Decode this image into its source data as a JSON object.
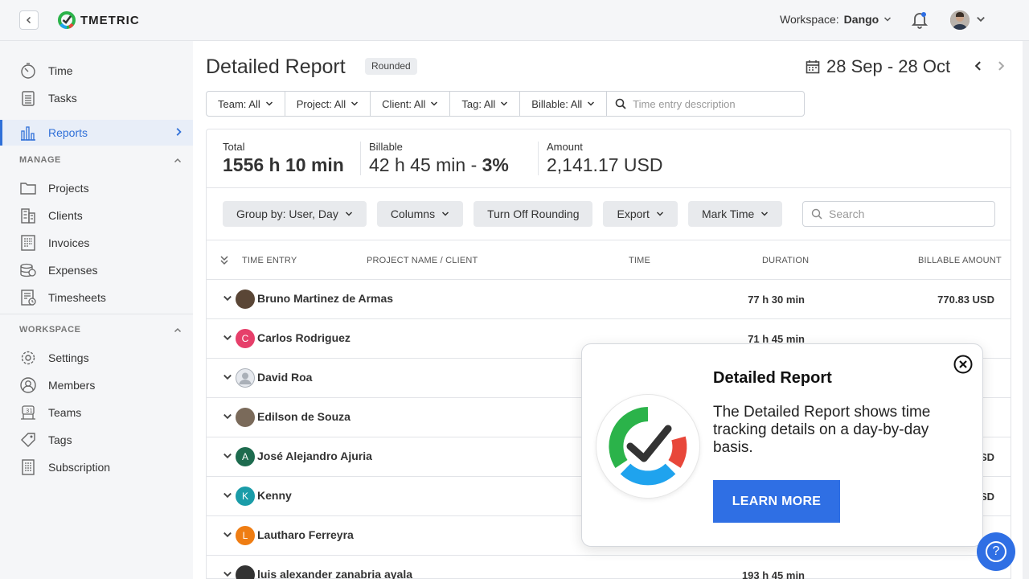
{
  "topbar": {
    "logo_text": "TMETRIC",
    "workspace_label": "Workspace:",
    "workspace_name": "Dango"
  },
  "sidebar": {
    "items_top": [
      {
        "label": "Time",
        "icon": "stopwatch-icon"
      },
      {
        "label": "Tasks",
        "icon": "clipboard-icon"
      },
      {
        "label": "Reports",
        "icon": "bar-chart-icon"
      }
    ],
    "manage_label": "MANAGE",
    "manage_items": [
      {
        "label": "Projects",
        "icon": "folder-icon"
      },
      {
        "label": "Clients",
        "icon": "building-icon"
      },
      {
        "label": "Invoices",
        "icon": "invoice-icon"
      },
      {
        "label": "Expenses",
        "icon": "coins-icon"
      },
      {
        "label": "Timesheets",
        "icon": "timesheet-icon"
      }
    ],
    "workspace_label": "WORKSPACE",
    "workspace_items": [
      {
        "label": "Settings",
        "icon": "gear-icon"
      },
      {
        "label": "Members",
        "icon": "user-icon"
      },
      {
        "label": "Teams",
        "icon": "teams-icon"
      },
      {
        "label": "Tags",
        "icon": "tag-icon"
      },
      {
        "label": "Subscription",
        "icon": "document-icon"
      }
    ]
  },
  "main": {
    "title": "Detailed Report",
    "badge": "Rounded",
    "date_range": "28 Sep - 28 Oct",
    "filters": [
      "Team: All",
      "Project: All",
      "Client: All",
      "Tag: All",
      "Billable: All"
    ],
    "filter_search_placeholder": "Time entry description",
    "totals": {
      "total_label": "Total",
      "total_value": "1556 h 10 min",
      "billable_label": "Billable",
      "billable_value": "42 h 45 min - ",
      "billable_pct": "3%",
      "amount_label": "Amount",
      "amount_value": "2,141.17 USD"
    },
    "toolbar": [
      "Group by: User, Day",
      "Columns",
      "Turn Off Rounding",
      "Export",
      "Mark Time"
    ],
    "search_placeholder": "Search",
    "columns": {
      "time_entry": "TIME ENTRY",
      "project_client": "PROJECT NAME / CLIENT",
      "time": "TIME",
      "duration": "DURATION",
      "billable_amount": "BILLABLE AMOUNT"
    },
    "rows": [
      {
        "name": "Bruno Martinez de Armas",
        "duration": "77 h 30 min",
        "amount": "770.83 USD",
        "initial": "",
        "color": "#5a4636"
      },
      {
        "name": "Carlos Rodriguez",
        "duration": "71 h 45 min",
        "amount": "",
        "initial": "C",
        "color": "#e63f6a"
      },
      {
        "name": "David Roa",
        "duration": "",
        "amount": "",
        "initial": "",
        "color": "#c9ced6"
      },
      {
        "name": "Edilson de Souza",
        "duration": "",
        "amount": "",
        "initial": "",
        "color": "#7a6a5a"
      },
      {
        "name": "José Alejandro Ajuria",
        "duration": "",
        "amount": "SD",
        "initial": "A",
        "color": "#1d6b4e"
      },
      {
        "name": "Kenny",
        "duration": "",
        "amount": "SD",
        "initial": "K",
        "color": "#1a9ca8"
      },
      {
        "name": "Lautharo Ferreyra",
        "duration": "",
        "amount": "",
        "initial": "L",
        "color": "#ef7d13"
      },
      {
        "name": "luis alexander zanabria ayala",
        "duration": "193 h 45 min",
        "amount": "",
        "initial": "",
        "color": "#333333"
      }
    ]
  },
  "popup": {
    "title": "Detailed Report",
    "text": "The Detailed Report shows time tracking details on a day-by-day basis.",
    "button": "LEARN MORE"
  },
  "help": {
    "label": "?"
  },
  "colors": {
    "accent": "#3070d8",
    "button_blue": "#2f6fe4"
  }
}
